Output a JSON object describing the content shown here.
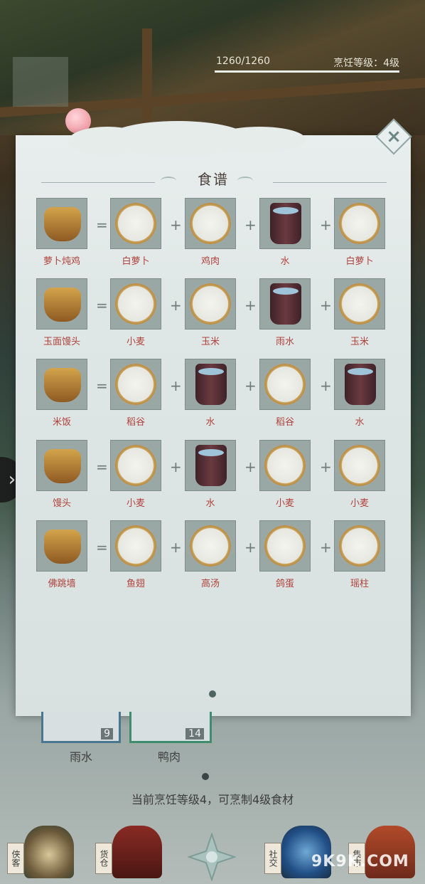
{
  "header": {
    "progress_text": "1260/1260",
    "progress_fraction": 1.0,
    "cook_level_text": "烹饪等级：4级"
  },
  "panel": {
    "title": "食谱",
    "close_icon": "close-icon",
    "page_indicator": "page-dot"
  },
  "recipes": [
    {
      "result": "萝卜炖鸡",
      "ingredients": [
        "白萝卜",
        "鸡肉",
        "水",
        "白萝卜"
      ],
      "ops": [
        "=",
        "+",
        "+",
        "+"
      ]
    },
    {
      "result": "玉面馒头",
      "ingredients": [
        "小麦",
        "玉米",
        "雨水",
        "玉米"
      ],
      "ops": [
        "=",
        "+",
        "+",
        "+"
      ]
    },
    {
      "result": "米饭",
      "ingredients": [
        "稻谷",
        "水",
        "稻谷",
        "水"
      ],
      "ops": [
        "=",
        "+",
        "+",
        "+"
      ]
    },
    {
      "result": "馒头",
      "ingredients": [
        "小麦",
        "水",
        "小麦",
        "小麦"
      ],
      "ops": [
        "=",
        "+",
        "+",
        "+"
      ]
    },
    {
      "result": "佛跳墙",
      "ingredients": [
        "鱼翅",
        "高汤",
        "鸽蛋",
        "瑶柱"
      ],
      "ops": [
        "=",
        "+",
        "+",
        "+"
      ]
    }
  ],
  "inventory": [
    {
      "name": "雨水",
      "count": "9"
    },
    {
      "name": "鸭肉",
      "count": "14"
    }
  ],
  "cook_hint": "当前烹饪等级4，可烹制4级食材",
  "nav": {
    "items": [
      "侠客",
      "货仓",
      "社交",
      "集市"
    ]
  },
  "watermark": "9K9K.COM",
  "side_arrow": "›",
  "colors": {
    "label_red": "#b0413b",
    "panel_bg": "#e2e9e8"
  }
}
